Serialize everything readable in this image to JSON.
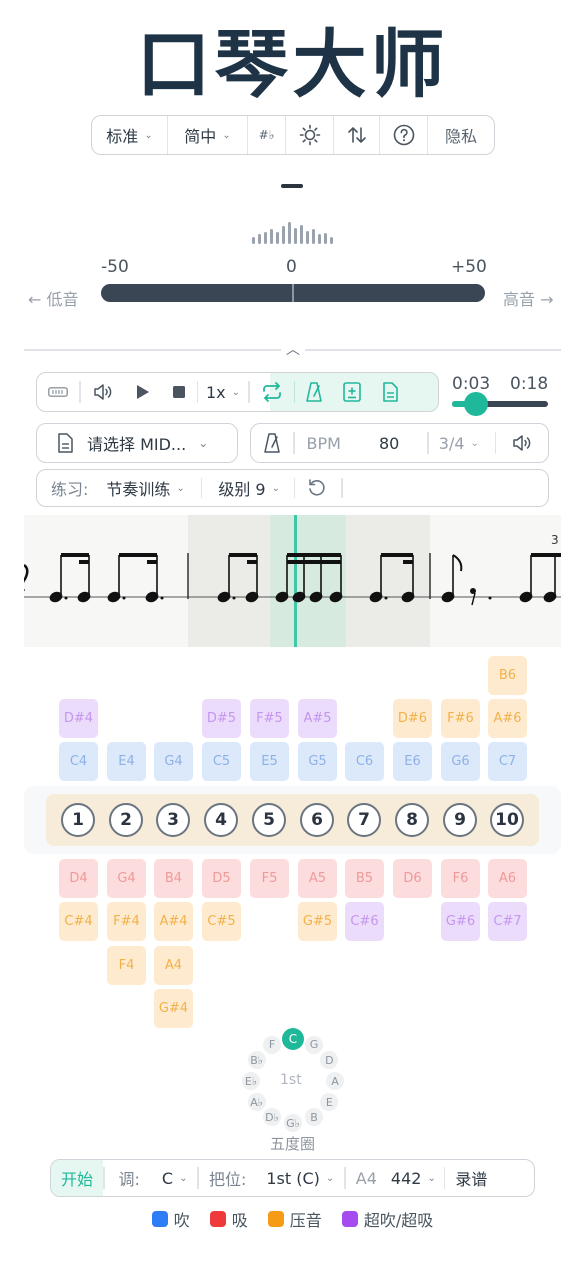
{
  "app": {
    "title": "口琴大师"
  },
  "toolbar": {
    "tuning": "标准",
    "language": "简中",
    "accidental": "#♭",
    "privacy": "隐私"
  },
  "tuner": {
    "current_note": "—",
    "scale_min": "-50",
    "scale_mid": "0",
    "scale_max": "+50",
    "low_label": "← 低音",
    "high_label": "高音 →"
  },
  "transport": {
    "speed": "1x",
    "time_current": "0:03",
    "time_total": "0:18",
    "progress": 0.25
  },
  "midi": {
    "placeholder": "请选择 MID..."
  },
  "tempo": {
    "bpm_label": "BPM",
    "bpm_value": "80",
    "time_signature": "3/4"
  },
  "practice": {
    "label": "练习:",
    "mode": "节奏训练",
    "level": "级别 9"
  },
  "score": {
    "tuplet_marker": "3"
  },
  "harmonica": {
    "holes": [
      "1",
      "2",
      "3",
      "4",
      "5",
      "6",
      "7",
      "8",
      "9",
      "10"
    ],
    "blow_top_extra": [
      "B6"
    ],
    "overblow_row": [
      "D#4",
      "",
      "",
      "D#5",
      "F#5",
      "A#5",
      "",
      "D#6",
      "F#6",
      "A#6"
    ],
    "blow": [
      "C4",
      "E4",
      "G4",
      "C5",
      "E5",
      "G5",
      "C6",
      "E6",
      "G6",
      "C7"
    ],
    "draw": [
      "D4",
      "G4",
      "B4",
      "D5",
      "F5",
      "A5",
      "B5",
      "D6",
      "F6",
      "A6"
    ],
    "draw_bend1": [
      "C#4",
      "F#4",
      "A#4",
      "C#5",
      "",
      "G#5",
      "C#6",
      "",
      "G#6",
      "C#7"
    ],
    "draw_bend2": [
      "",
      "F4",
      "A4"
    ],
    "draw_bend3": [
      "",
      "",
      "G#4"
    ]
  },
  "circle_of_fifths": {
    "notes": [
      "C",
      "G",
      "D",
      "A",
      "E",
      "B",
      "G♭",
      "D♭",
      "A♭",
      "E♭",
      "B♭",
      "F"
    ],
    "active": "C",
    "position": "1st",
    "label": "五度圈"
  },
  "bottom": {
    "start": "开始",
    "key_label": "调:",
    "key_value": "C",
    "position_label": "把位:",
    "position_value": "1st (C)",
    "a4_label": "A4",
    "a4_value": "442",
    "record": "录谱"
  },
  "legend": [
    {
      "label": "吹",
      "color": "#2f7df6"
    },
    {
      "label": "吸",
      "color": "#ee3a3a"
    },
    {
      "label": "压音",
      "color": "#f59b16"
    },
    {
      "label": "超吹/超吸",
      "color": "#a54bf0"
    }
  ]
}
